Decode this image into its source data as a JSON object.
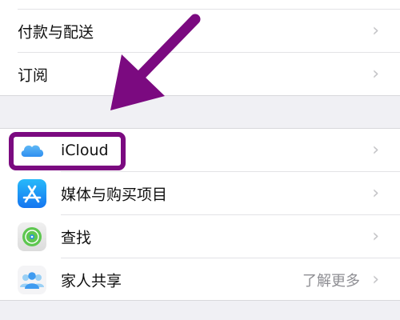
{
  "settings": {
    "group1": {
      "items": [
        {
          "label": "付款与配送"
        },
        {
          "label": "订阅"
        }
      ]
    },
    "group2": {
      "items": [
        {
          "label": "iCloud",
          "icon": "icloud-icon"
        },
        {
          "label": "媒体与购买项目",
          "icon": "app-store-icon"
        },
        {
          "label": "查找",
          "icon": "find-my-icon"
        },
        {
          "label": "家人共享",
          "icon": "family-sharing-icon",
          "detail": "了解更多"
        }
      ]
    }
  },
  "annotations": {
    "arrow_color": "#7b0a80",
    "highlight_color": "#7b0a80",
    "highlighted_item": "iCloud"
  },
  "colors": {
    "background": "#f0f0f4",
    "cell": "#ffffff",
    "chevron": "#c4c4c7",
    "secondary_text": "#8e8e93"
  }
}
